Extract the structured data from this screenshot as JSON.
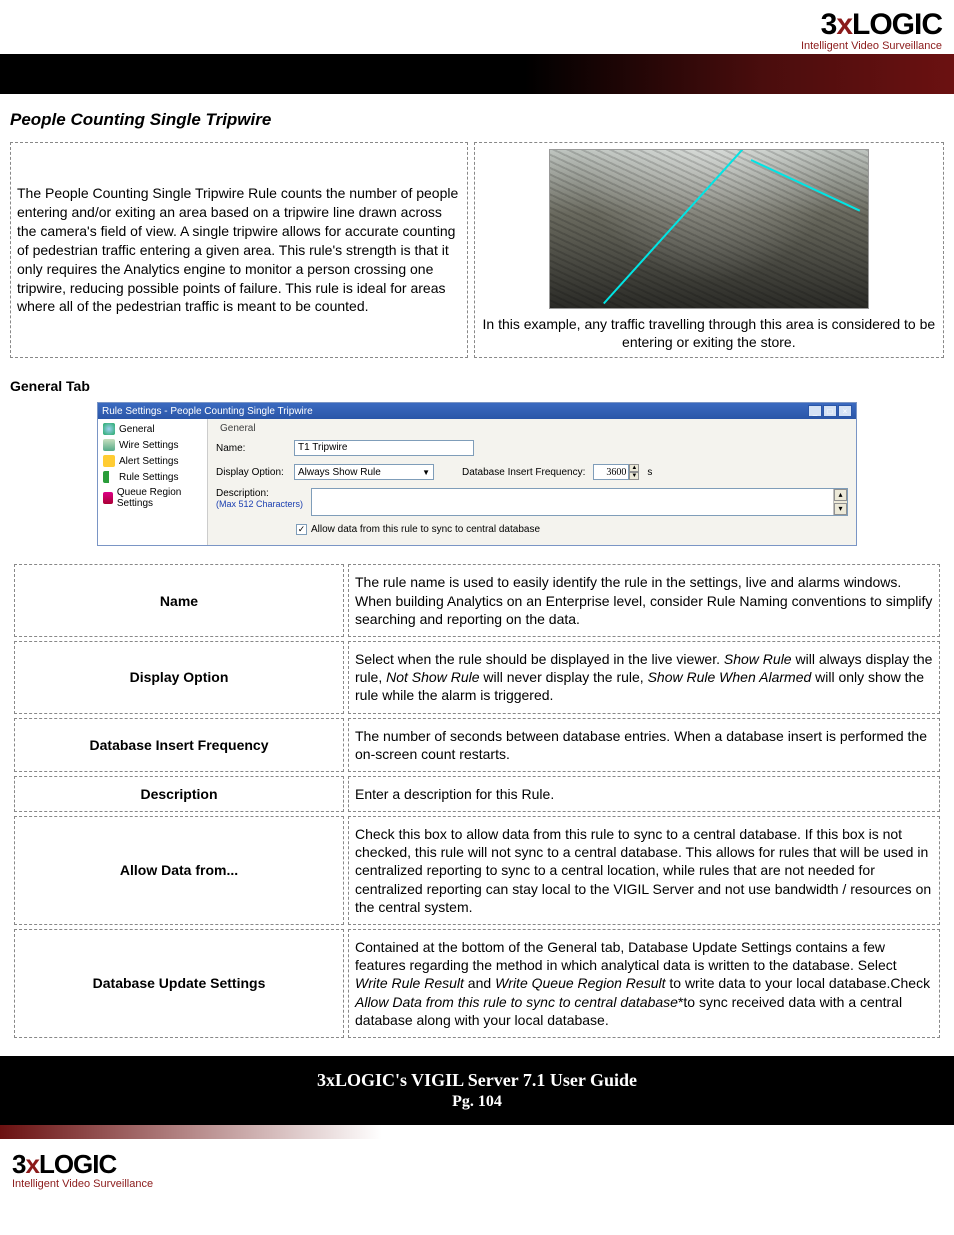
{
  "brand": {
    "logo3": "3",
    "logox": "x",
    "logologic": "LOGIC",
    "tagline": "Intelligent Video Surveillance"
  },
  "section_title": "People Counting Single Tripwire",
  "intro_text": "The People Counting Single Tripwire Rule counts the number of people entering and/or exiting an area based on a tripwire line drawn across the camera's field of view.  A single tripwire allows for accurate counting of pedestrian traffic entering a given area. This rule's strength is that it only requires the Analytics engine to monitor a person crossing one tripwire, reducing possible points of failure.  This rule is ideal for areas where all of the pedestrian traffic is meant to be counted.",
  "example_caption": "In this example, any traffic travelling through this area is considered to be entering or exiting the store.",
  "general_tab_heading": "General Tab",
  "window": {
    "title": "Rule Settings - People Counting Single Tripwire",
    "sidebar": {
      "items": [
        {
          "label": "General"
        },
        {
          "label": "Wire Settings"
        },
        {
          "label": "Alert Settings"
        },
        {
          "label": "Rule Settings"
        },
        {
          "label": "Queue Region Settings"
        }
      ]
    },
    "panel": {
      "group": "General",
      "name_label": "Name:",
      "name_value": "T1 Tripwire",
      "display_label": "Display Option:",
      "display_value": "Always Show Rule",
      "db_freq_label": "Database Insert Frequency:",
      "db_freq_value": "3600",
      "db_freq_unit": "s",
      "desc_label": "Description:",
      "max_chars": "(Max 512 Characters)",
      "checkbox_label": "Allow data from this rule to sync to central database"
    }
  },
  "table": {
    "rows": [
      {
        "label": "Name",
        "desc": "The rule name is used to easily identify the rule in the settings, live and alarms windows.  When building Analytics on an Enterprise level, consider Rule Naming conventions to simplify searching and reporting on the data."
      },
      {
        "label": "Display Option",
        "desc_parts": [
          "Select when the rule should be displayed in the live viewer. ",
          "Show Rule",
          " will always display the rule, ",
          "Not Show Rule",
          " will never display the rule, ",
          "Show Rule When Alarmed",
          " will only show the rule while the alarm is triggered."
        ]
      },
      {
        "label": "Database Insert Frequency",
        "desc": "The number of seconds between database entries. When a database insert is performed the on-screen count restarts."
      },
      {
        "label": "Description",
        "desc": "Enter a description for this Rule."
      },
      {
        "label": "Allow Data from...",
        "desc": "Check this box to allow data from this rule to sync to a central database.  If this box is not checked, this rule will not sync to a central database.  This allows for rules that will be used in centralized reporting to sync to a central location, while rules that are not needed for centralized reporting can stay local to the VIGIL Server and not use bandwidth / resources on the central system."
      },
      {
        "label": "Database Update Settings",
        "desc_parts": [
          "Contained at the bottom of the General tab, Database Update Settings  contains a few features regarding the method in which analytical data is written to the database. Select ",
          "Write Rule Result",
          " and ",
          "Write Queue Region Result",
          " to write data to your local database.Check ",
          "Allow Data from this rule to sync to central database",
          "*to sync received data with a central database along with your local database."
        ]
      }
    ]
  },
  "footer": {
    "title": "3xLOGIC's VIGIL Server 7.1 User Guide",
    "pg": "Pg. 104"
  }
}
